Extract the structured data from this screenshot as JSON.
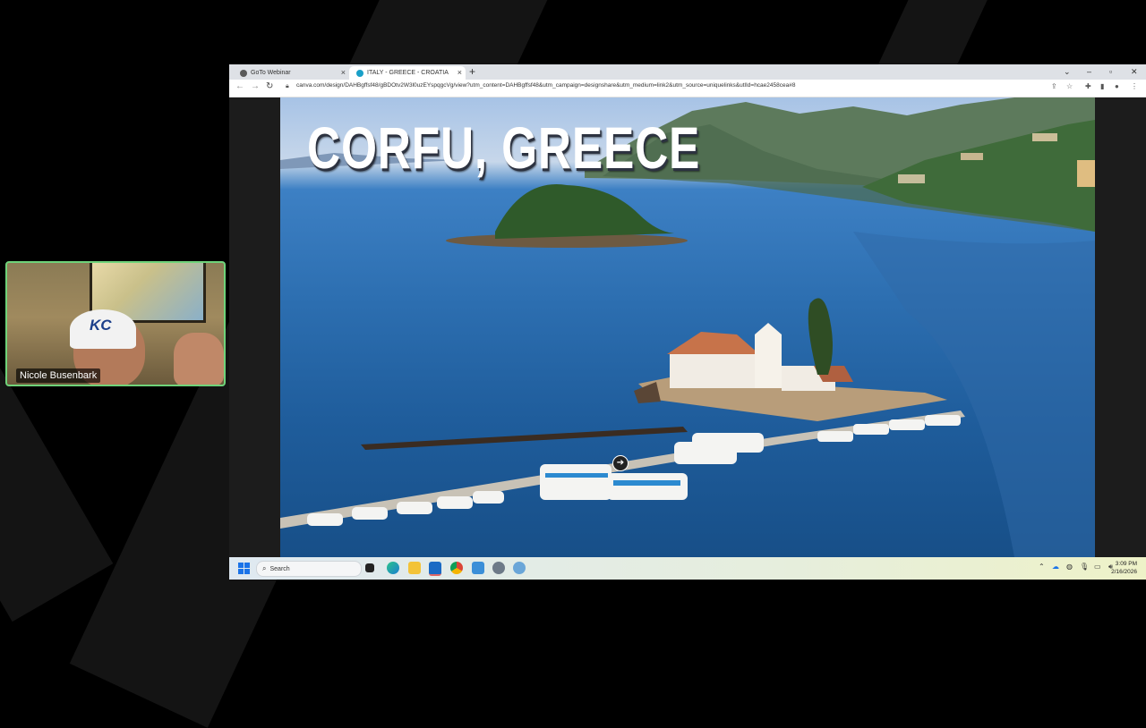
{
  "webcam": {
    "participant_name": "Nicole Busenbark",
    "cap_logo": "KC"
  },
  "browser": {
    "tabs": [
      {
        "label": "GoTo Webinar",
        "active": false,
        "favicon_color": "#5a5a5a"
      },
      {
        "label": "ITALY - GREECE - CROATIA",
        "active": true,
        "favicon_color": "#1aa0c8"
      }
    ],
    "new_tab_symbol": "+",
    "close_symbol": "×",
    "url": "canva.com/design/DAHBgffsf48/gBDOtv2W3l0uzEYspqgcVg/view?utm_content=DAHBgffsf48&utm_campaign=designshare&utm_medium=link2&utm_source=uniquelinks&utlId=hcae2458cea#8"
  },
  "slide": {
    "title": "CORFU, GREECE"
  },
  "taskbar": {
    "search_label": "Search",
    "time": "3:09 PM",
    "date": "2/16/2026"
  }
}
